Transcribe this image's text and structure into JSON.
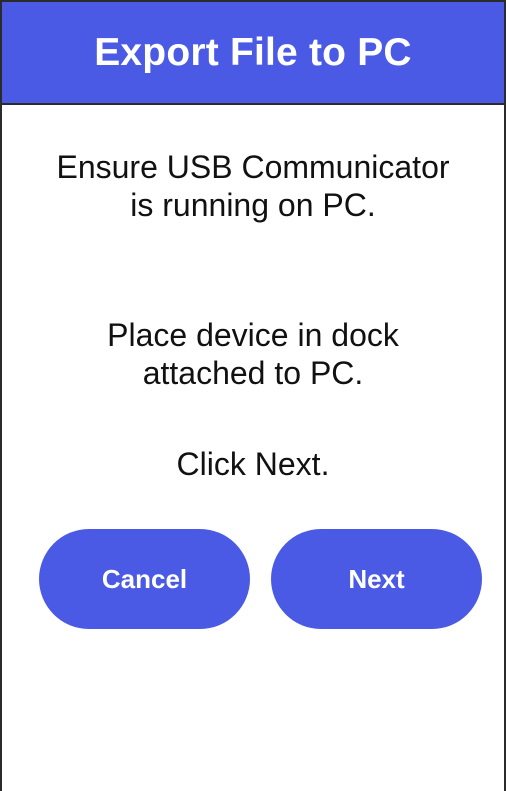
{
  "header": {
    "title": "Export File to PC"
  },
  "instructions": {
    "line1": "Ensure USB Communicator is running on PC.",
    "line2": "Place device in dock attached to PC.",
    "line3": "Click Next."
  },
  "buttons": {
    "cancel_label": "Cancel",
    "next_label": "Next"
  },
  "colors": {
    "accent": "#4a5ae5",
    "header_text": "#ffffff",
    "body_text": "#111111",
    "background": "#ffffff"
  }
}
